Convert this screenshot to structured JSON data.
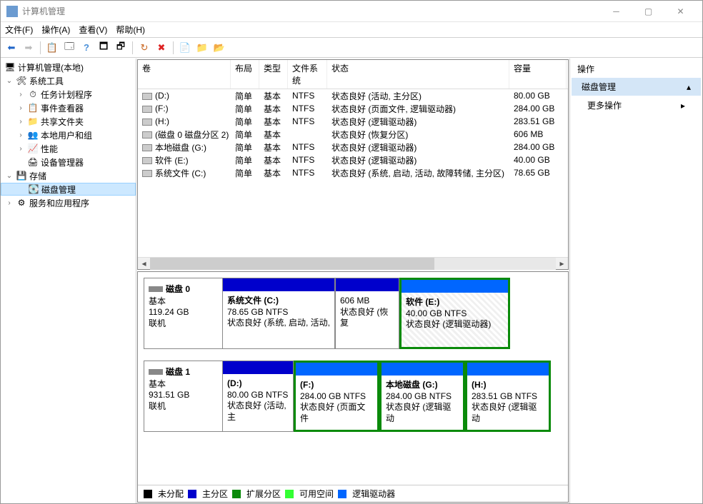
{
  "window": {
    "title": "计算机管理"
  },
  "menu": {
    "file": "文件(F)",
    "action": "操作(A)",
    "view": "查看(V)",
    "help": "帮助(H)"
  },
  "tree": {
    "root": "计算机管理(本地)",
    "system_tools": "系统工具",
    "task_scheduler": "任务计划程序",
    "event_viewer": "事件查看器",
    "shared_folders": "共享文件夹",
    "local_users": "本地用户和组",
    "performance": "性能",
    "device_manager": "设备管理器",
    "storage": "存储",
    "disk_management": "磁盘管理",
    "services": "服务和应用程序"
  },
  "columns": {
    "volume": "卷",
    "layout": "布局",
    "type": "类型",
    "fs": "文件系统",
    "status": "状态",
    "capacity": "容量"
  },
  "volumes": [
    {
      "name": "(D:)",
      "layout": "简单",
      "type": "基本",
      "fs": "NTFS",
      "status": "状态良好 (活动, 主分区)",
      "capacity": "80.00 GB"
    },
    {
      "name": "(F:)",
      "layout": "简单",
      "type": "基本",
      "fs": "NTFS",
      "status": "状态良好 (页面文件, 逻辑驱动器)",
      "capacity": "284.00 GB"
    },
    {
      "name": "(H:)",
      "layout": "简单",
      "type": "基本",
      "fs": "NTFS",
      "status": "状态良好 (逻辑驱动器)",
      "capacity": "283.51 GB"
    },
    {
      "name": "(磁盘 0 磁盘分区 2)",
      "layout": "简单",
      "type": "基本",
      "fs": "",
      "status": "状态良好 (恢复分区)",
      "capacity": "606 MB"
    },
    {
      "name": "本地磁盘 (G:)",
      "layout": "简单",
      "type": "基本",
      "fs": "NTFS",
      "status": "状态良好 (逻辑驱动器)",
      "capacity": "284.00 GB"
    },
    {
      "name": "软件 (E:)",
      "layout": "简单",
      "type": "基本",
      "fs": "NTFS",
      "status": "状态良好 (逻辑驱动器)",
      "capacity": "40.00 GB"
    },
    {
      "name": "系统文件 (C:)",
      "layout": "简单",
      "type": "基本",
      "fs": "NTFS",
      "status": "状态良好 (系统, 启动, 活动, 故障转储, 主分区)",
      "capacity": "78.65 GB"
    }
  ],
  "disks": [
    {
      "name": "磁盘 0",
      "type": "基本",
      "size": "119.24 GB",
      "status": "联机",
      "partitions": [
        {
          "label": "系统文件  (C:)",
          "size": "78.65 GB NTFS",
          "status": "状态良好 (系统, 启动, 活动,",
          "kind": "primary",
          "width": 158,
          "selected": false
        },
        {
          "label": "",
          "size": "606 MB",
          "status": "状态良好 (恢复",
          "kind": "primary",
          "width": 90,
          "selected": false
        },
        {
          "label": "软件  (E:)",
          "size": "40.00 GB NTFS",
          "status": "状态良好 (逻辑驱动器)",
          "kind": "logical",
          "width": 155,
          "selected": true,
          "ext": true
        }
      ]
    },
    {
      "name": "磁盘 1",
      "type": "基本",
      "size": "931.51 GB",
      "status": "联机",
      "partitions": [
        {
          "label": "(D:)",
          "size": "80.00 GB NTFS",
          "status": "状态良好 (活动, 主",
          "kind": "primary",
          "width": 100,
          "selected": false
        },
        {
          "label": "(F:)",
          "size": "284.00 GB NTFS",
          "status": "状态良好 (页面文件",
          "kind": "logical",
          "width": 120,
          "selected": false,
          "ext": true
        },
        {
          "label": "本地磁盘  (G:)",
          "size": "284.00 GB NTFS",
          "status": "状态良好 (逻辑驱动",
          "kind": "logical",
          "width": 120,
          "selected": false,
          "ext": true
        },
        {
          "label": "(H:)",
          "size": "283.51 GB NTFS",
          "status": "状态良好 (逻辑驱动",
          "kind": "logical",
          "width": 120,
          "selected": false,
          "ext": true
        }
      ]
    }
  ],
  "legend": {
    "unallocated": "未分配",
    "primary": "主分区",
    "extended": "扩展分区",
    "free": "可用空间",
    "logical": "逻辑驱动器"
  },
  "actions": {
    "header": "操作",
    "section": "磁盘管理",
    "more": "更多操作"
  }
}
